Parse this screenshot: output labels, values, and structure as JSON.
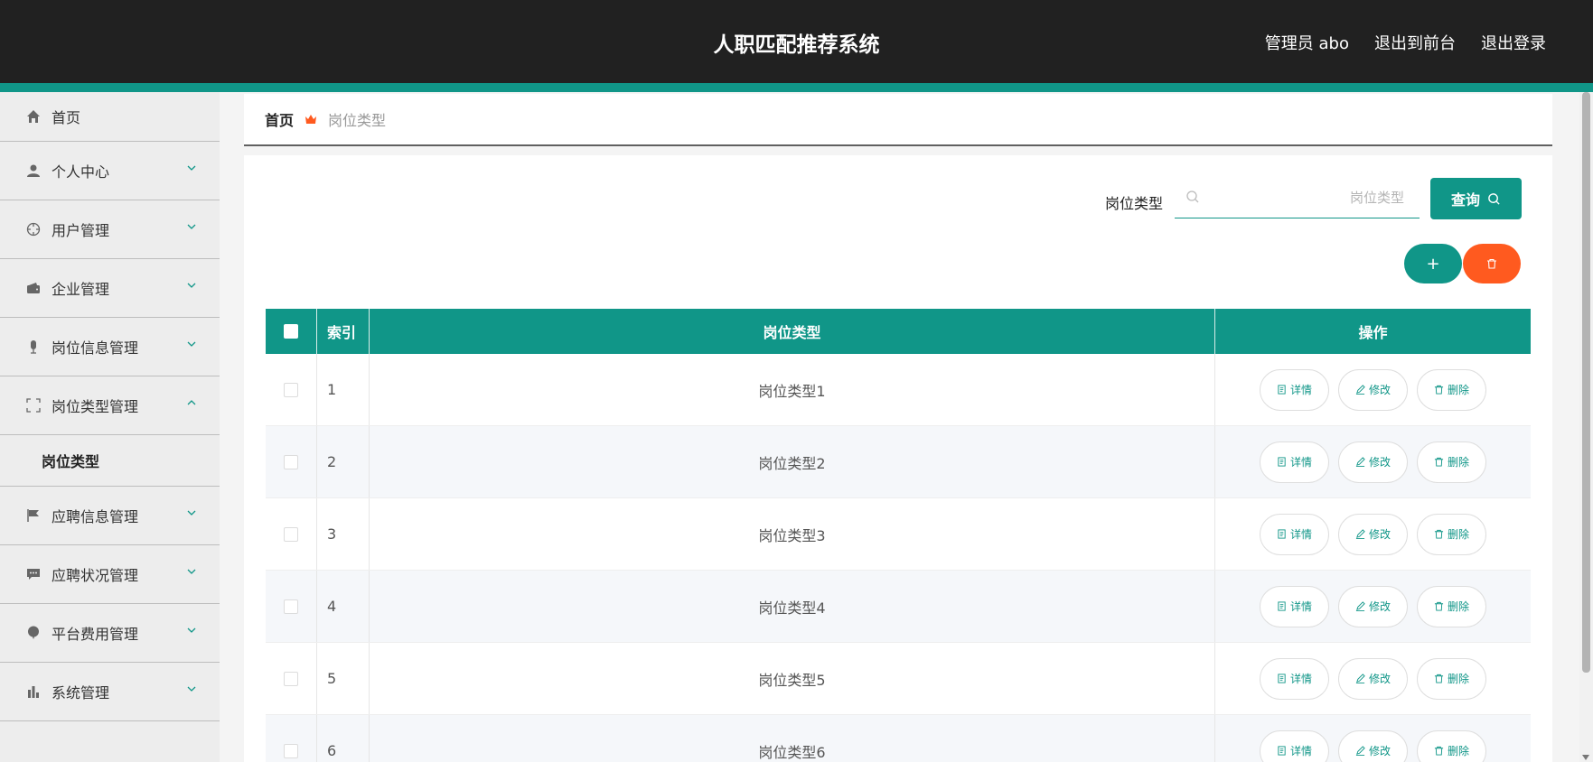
{
  "header": {
    "title": "人职匹配推荐系统",
    "links": [
      "管理员 abo",
      "退出到前台",
      "退出登录"
    ]
  },
  "sidebar": {
    "items": [
      {
        "label": "首页",
        "icon": "home-icon",
        "expandable": false
      },
      {
        "label": "个人中心",
        "icon": "user-icon",
        "expandable": true
      },
      {
        "label": "用户管理",
        "icon": "crosshair-icon",
        "expandable": true
      },
      {
        "label": "企业管理",
        "icon": "wallet-icon",
        "expandable": true
      },
      {
        "label": "岗位信息管理",
        "icon": "microphone-icon",
        "expandable": true
      },
      {
        "label": "岗位类型管理",
        "icon": "frame-icon",
        "expandable": true,
        "expanded": true
      },
      {
        "label": "应聘信息管理",
        "icon": "flag-icon",
        "expandable": true
      },
      {
        "label": "应聘状况管理",
        "icon": "message-icon",
        "expandable": true
      },
      {
        "label": "平台费用管理",
        "icon": "balloon-icon",
        "expandable": true
      },
      {
        "label": "系统管理",
        "icon": "bar-chart-icon",
        "expandable": true
      }
    ],
    "submenu": "岗位类型"
  },
  "breadcrumb": {
    "home": "首页",
    "current": "岗位类型"
  },
  "search": {
    "label": "岗位类型",
    "placeholder": "岗位类型",
    "value": "",
    "button": "查询"
  },
  "actions": {
    "add": "+"
  },
  "table": {
    "headers": {
      "index": "索引",
      "type": "岗位类型",
      "ops": "操作"
    },
    "rows": [
      {
        "index": "1",
        "type": "岗位类型1"
      },
      {
        "index": "2",
        "type": "岗位类型2"
      },
      {
        "index": "3",
        "type": "岗位类型3"
      },
      {
        "index": "4",
        "type": "岗位类型4"
      },
      {
        "index": "5",
        "type": "岗位类型5"
      },
      {
        "index": "6",
        "type": "岗位类型6"
      }
    ],
    "op_labels": {
      "detail": "详情",
      "edit": "修改",
      "delete": "删除"
    }
  },
  "colors": {
    "primary": "#109688",
    "danger": "#ff5a1f",
    "header_bg": "#212121"
  }
}
